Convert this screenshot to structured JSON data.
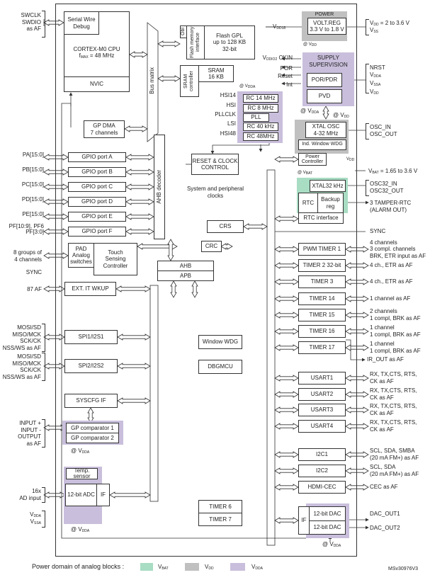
{
  "colors": {
    "vbat": "#a8dcc3",
    "vdd": "#c0c0c0",
    "vdda": "#c9bfdc",
    "line": "#333333"
  },
  "left": {
    "swd": [
      "SWCLK",
      "SWDIO",
      "as AF"
    ],
    "ports": [
      "PA[15:0]",
      "PB[15:0]",
      "PC[15:0]",
      "PD[15:0]",
      "PE[15:0]",
      "PF[10:9], PF6",
      "PF[3:0]"
    ],
    "touch_in": [
      "8 groups of",
      "4 channels"
    ],
    "sync": "SYNC",
    "af87": "87 AF",
    "spi1": [
      "MOSI/SD",
      "MISO/MCK",
      "SCK/CK",
      "NSS/WS as AF"
    ],
    "spi2": [
      "MOSI/SD",
      "MISO/MCK",
      "SCK/CK",
      "NSS/WS as AF"
    ],
    "comp": [
      "INPUT +",
      "INPUT -",
      "OUTPUT",
      "as AF"
    ],
    "adc": [
      "16x",
      "AD input"
    ],
    "vdda": {
      "v": "V",
      "sub": "DDA"
    },
    "vssa": {
      "v": "V",
      "sub": "SSA"
    }
  },
  "blocks": {
    "swd": "Serial Wire Debug",
    "cpu": "CORTEX-M0 CPU",
    "fmax": {
      "f": "f",
      "sub": "MAX",
      "rest": " = 48 MHz"
    },
    "nvic": "NVIC",
    "bus_matrix": "Bus matrix",
    "obl": "Obl",
    "flash_if": "Flash memory interface",
    "flash": [
      "Flash GPL",
      "up to 128 KB",
      "32-bit"
    ],
    "sram_ctrl": "SRAM controller",
    "sram": [
      "SRAM",
      "16 KB"
    ],
    "dma": [
      "GP DMA",
      "7 channels"
    ],
    "gpio": [
      "GPIO port A",
      "GPIO port B",
      "GPIO port C",
      "GPIO port D",
      "GPIO port E",
      "GPIO port F"
    ],
    "ahb_decoder": "AHB decoder",
    "pad": [
      "PAD",
      "Analog",
      "switches"
    ],
    "tsc": [
      "Touch",
      "Sensing",
      "Controller"
    ],
    "ext": "EXT. IT  WKUP",
    "spi1": "SPI1/I2S1",
    "spi2": "SPI2/I2S2",
    "syscfg": "SYSCFG IF",
    "comp1": "GP comparator 1",
    "comp2": "GP comparator 2",
    "temp": [
      "Temp.",
      "sensor"
    ],
    "adc": "12-bit ADC",
    "adc_if": "IF",
    "rcc": [
      "RESET & CLOCK",
      "CONTROL"
    ],
    "sysclk": [
      "System and peripheral",
      "clocks"
    ],
    "crs": "CRS",
    "crc": "CRC",
    "ahb": "AHB",
    "apb": "APB",
    "wwdg": "Window WDG",
    "dbgmcu": "DBGMCU",
    "tim6": "TIMER 6",
    "tim7": "TIMER 7",
    "power": "POWER",
    "voltreg": [
      "VOLT.REG",
      "3.3 V to 1.8 V"
    ],
    "supply": [
      "SUPPLY",
      "SUPERVISION"
    ],
    "porpdr": "POR/PDR",
    "pvd": "PVD",
    "clk_sig": [
      "HSI14",
      "HSI",
      "PLLCLK",
      "LSI",
      "HSI48"
    ],
    "rc": [
      "RC 14 MHz",
      "RC 8 MHz",
      "PLL",
      "RC 40 kHz",
      "RC 48MHz"
    ],
    "xtal": [
      "XTAL OSC",
      "4-32 MHz"
    ],
    "iwdg": "Ind. Window WDG",
    "pwrctrl": [
      "Power",
      "Controller"
    ],
    "xtal32": "XTAL32 kHz",
    "rtc": "RTC",
    "backup": [
      "Backup",
      "reg"
    ],
    "rtc_if": "RTC interface",
    "periph": [
      "PWM TIMER 1",
      "TIMER 2 32-bit",
      "TIMER 3",
      "TIMER 14",
      "TIMER 15",
      "TIMER 16",
      "TIMER 17",
      "USART1",
      "USART2",
      "USART3",
      "USART4",
      "I2C1",
      "I2C2",
      "HDMI-CEC"
    ],
    "dac_if": "IF",
    "dac1": "12-bit  DAC",
    "dac2": "12-bit DAC"
  },
  "right": {
    "vdd18": {
      "v": "V",
      "sub": "DD18"
    },
    "vdd_range": {
      "v": "V",
      "sub": "DD",
      "rest": " = 2 to 3.6 V"
    },
    "vss": {
      "v": "V",
      "sub": "SS"
    },
    "okin": {
      "v": "V",
      "sub": "DDIO2",
      "rest": " OKIN"
    },
    "por": "POR",
    "reset": "Reset",
    "int": "Int",
    "nrst": "NRST",
    "sup_pins": [
      {
        "v": "V",
        "sub": "DDA"
      },
      {
        "v": "V",
        "sub": "SSA"
      },
      {
        "v": "V",
        "sub": "DD"
      }
    ],
    "osc": [
      "OSC_IN",
      "OSC_OUT"
    ],
    "vbat": {
      "v": "V",
      "sub": "BAT",
      "rest": " = 1.65 to 3.6 V"
    },
    "vdd_sw": {
      "v": "V",
      "sub": "DD"
    },
    "osc32": [
      "OSC32_IN",
      "OSC32_OUT"
    ],
    "tamper": [
      "3 TAMPER-RTC",
      "(ALARM OUT)"
    ],
    "sync": "SYNC",
    "periph_af": [
      [
        "4 channels",
        "3 compl. channels",
        "BRK, ETR input as AF"
      ],
      [
        "4 ch., ETR as AF"
      ],
      [
        "4 ch., ETR as AF"
      ],
      [
        "1 channel as AF"
      ],
      [
        "2 channels",
        "1 compl, BRK as AF"
      ],
      [
        "1 channel",
        "1 compl, BRK as AF"
      ],
      [
        "1 channel",
        "1 compl, BRK as AF"
      ],
      [
        "RX, TX,CTS, RTS,",
        "CK as AF"
      ],
      [
        "RX, TX,CTS, RTS,",
        "CK as AF"
      ],
      [
        "RX, TX,CTS, RTS,",
        "CK as AF"
      ],
      [
        "RX, TX,CTS, RTS,",
        "CK as AF"
      ],
      [
        "SCL, SDA, SMBA",
        "(20 mA FM+) as AF"
      ],
      [
        "SCL, SDA",
        "(20 mA FM+) as AF"
      ],
      [
        "CEC as AF"
      ]
    ],
    "ir_out": "IR_OUT as AF",
    "dac_out": [
      "DAC_OUT1",
      "DAC_OUT2"
    ]
  },
  "domains": {
    "at": "@ ",
    "vdd": {
      "v": "V",
      "sub": "DD"
    },
    "vdda": {
      "v": "V",
      "sub": "DDA"
    },
    "vbat": {
      "v": "V",
      "sub": "BAT"
    }
  },
  "legend": {
    "title": "Power domain of analog blocks :",
    "items": [
      {
        "v": "V",
        "sub": "BAT"
      },
      {
        "v": "V",
        "sub": "DD"
      },
      {
        "v": "V",
        "sub": "DDA"
      }
    ]
  },
  "ref": "MSv30976V3"
}
